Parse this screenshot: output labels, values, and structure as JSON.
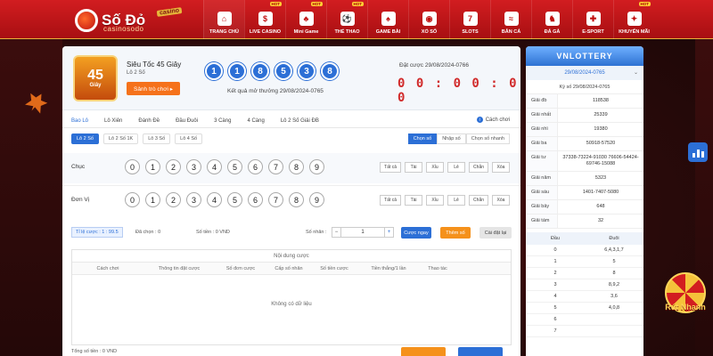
{
  "brand": {
    "name": "Số Đỏ",
    "badge": "casino",
    "sub": "casinosodo"
  },
  "nav": [
    {
      "label": "TRANG CHỦ",
      "icon": "home-icon",
      "glyph": "⌂",
      "hot": ""
    },
    {
      "label": "LIVE CASINO",
      "icon": "casino-chip-icon",
      "glyph": "$",
      "hot": "HOT"
    },
    {
      "label": "Mini Game",
      "icon": "mini-game-icon",
      "glyph": "♣",
      "hot": "HOT"
    },
    {
      "label": "THỂ THAO",
      "icon": "sports-icon",
      "glyph": "⚽",
      "hot": "HOT"
    },
    {
      "label": "GAME BÀI",
      "icon": "cards-icon",
      "glyph": "♠",
      "hot": ""
    },
    {
      "label": "XỔ SỐ",
      "icon": "lottery-icon",
      "glyph": "◉",
      "hot": ""
    },
    {
      "label": "SLOTS",
      "icon": "slots-icon",
      "glyph": "7",
      "hot": ""
    },
    {
      "label": "BẮN CÁ",
      "icon": "fish-icon",
      "glyph": "≈",
      "hot": ""
    },
    {
      "label": "ĐÁ GÀ",
      "icon": "rooster-icon",
      "glyph": "♞",
      "hot": ""
    },
    {
      "label": "E-SPORT",
      "icon": "gamepad-icon",
      "glyph": "✚",
      "hot": ""
    },
    {
      "label": "KHUYẾN MÃI",
      "icon": "gift-icon",
      "glyph": "✦",
      "hot": "HOT"
    }
  ],
  "game": {
    "thumb_big": "45",
    "thumb_small": "Giây",
    "title": "Siêu Tốc 45 Giây",
    "sub": "Lô 2 Số",
    "enter_button": "Sảnh trò chơi ▸"
  },
  "result": {
    "balls": [
      "1",
      "1",
      "8",
      "5",
      "3",
      "8"
    ],
    "label": "Kết quả mở thưởng 29/08/2024-0765"
  },
  "betting": {
    "period_label": "Đặt cược 29/08/2024-0766",
    "countdown": "0 0 : 0 0 : 0 0"
  },
  "tabs": [
    "Bao Lô",
    "Lô Xiên",
    "Đánh Đề",
    "Đầu Đuôi",
    "3 Càng",
    "4 Càng",
    "Lô 2 Số Giải ĐB"
  ],
  "howto": "Cách chơi",
  "subtabs": [
    "Lô 2 Số",
    "Lô 2 Số 1K",
    "Lô 3 Số",
    "Lô 4 Số"
  ],
  "modes": [
    "Chọn số",
    "Nhập số",
    "Chọn số nhanh"
  ],
  "rows": [
    {
      "label": "Chục",
      "numbers": [
        "0",
        "1",
        "2",
        "3",
        "4",
        "5",
        "6",
        "7",
        "8",
        "9"
      ]
    },
    {
      "label": "Đơn Vị",
      "numbers": [
        "0",
        "1",
        "2",
        "3",
        "4",
        "5",
        "6",
        "7",
        "8",
        "9"
      ]
    }
  ],
  "quick": [
    "Tất cả",
    "Tài",
    "Xỉu",
    "Lẻ",
    "Chẵn",
    "Xóa"
  ],
  "controls": {
    "ratio": "Tỉ lệ cược : 1 : 99.5",
    "chosen": "Đã chọn : 0",
    "money": "Số tiền : 0 VND",
    "mult_label": "Số nhân :",
    "minus": "−",
    "mult_value": "1",
    "plus": "+",
    "bet_now": "Cược ngay",
    "add": "Thêm số",
    "reset": "Cài đặt lại"
  },
  "bet_table": {
    "caption": "Nội dung cược",
    "headers": [
      "Cách chơi",
      "Thông tin đặt cược",
      "Số đơn cược",
      "Cấp số nhân",
      "Số tiền cược",
      "Tiền thắng/1 lần",
      "Thao tác"
    ],
    "empty": "Không có dữ liệu"
  },
  "total": "Tổng số tiền : 0 VND",
  "right": {
    "logo": "VNLOTTERY",
    "date": "29/08/2024-0765",
    "ky": "Kỳ số 29/08/2024-0765",
    "prizes": [
      {
        "label": "Giải đb",
        "value": "118538"
      },
      {
        "label": "Giải nhất",
        "value": "25339"
      },
      {
        "label": "Giải nhì",
        "value": "19380"
      },
      {
        "label": "Giải ba",
        "value": "50918-57520"
      },
      {
        "label": "Giải tư",
        "value": "37338-73224-91030 76606-54424-69746-15088"
      },
      {
        "label": "Giải năm",
        "value": "5323"
      },
      {
        "label": "Giải sáu",
        "value": "1401-7407-5080"
      },
      {
        "label": "Giải bảy",
        "value": "648"
      },
      {
        "label": "Giải tám",
        "value": "32"
      }
    ],
    "dd_headers": [
      "Đầu",
      "Đuôi"
    ],
    "dd_rows": [
      [
        "0",
        "6,4,3,1,7"
      ],
      [
        "1",
        "5"
      ],
      [
        "2",
        "8"
      ],
      [
        "3",
        "8,9,2"
      ],
      [
        "4",
        "3,6"
      ],
      [
        "5",
        "4,0,8"
      ],
      [
        "6",
        ""
      ],
      [
        "7",
        ""
      ]
    ]
  },
  "promo": {
    "text": "Rút Nhanh"
  }
}
